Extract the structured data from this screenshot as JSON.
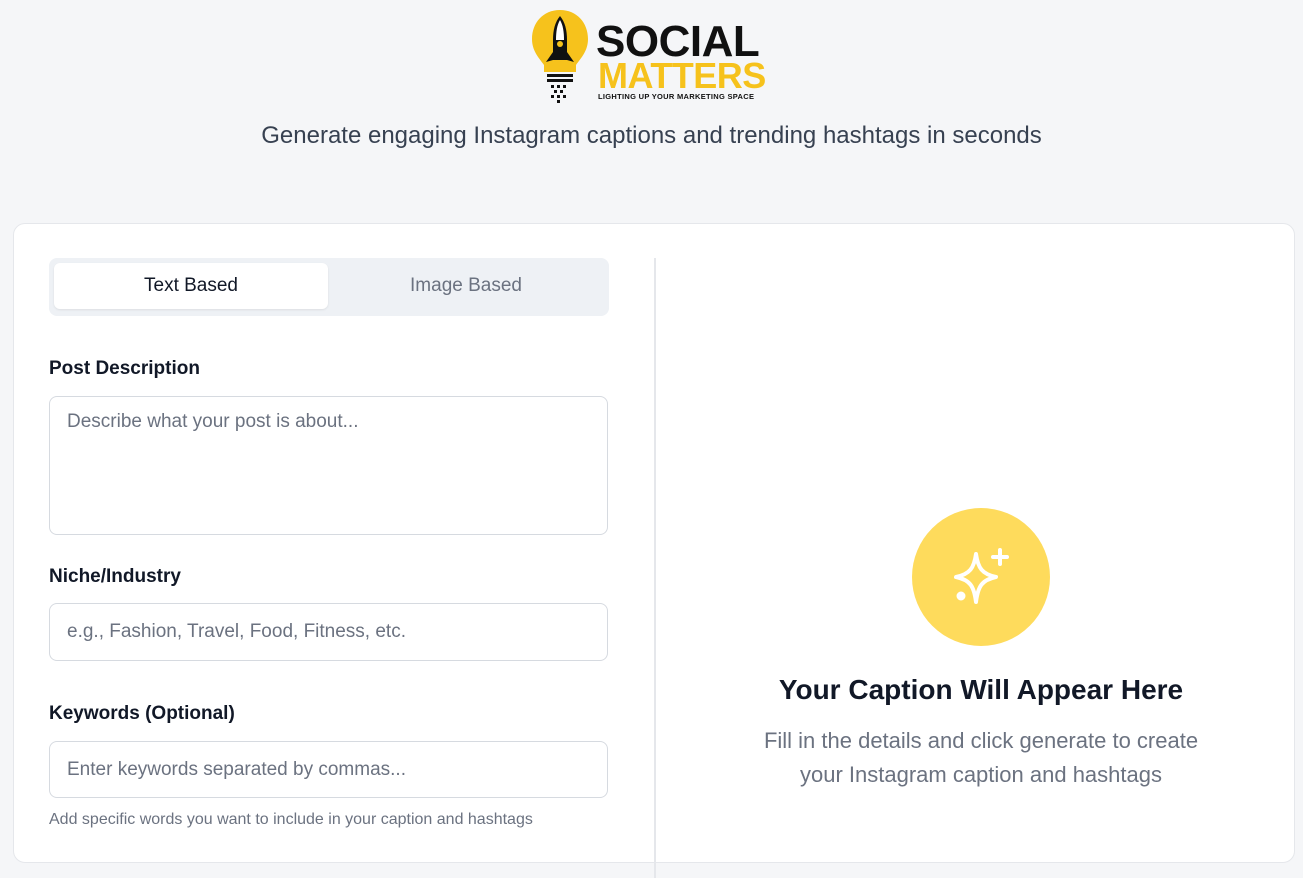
{
  "logo": {
    "brand_top": "SOCIAL",
    "brand_bottom": "MATTERS",
    "tagline": "LIGHTING UP YOUR MARKETING SPACE",
    "bulb_icon": "lightbulb-rocket-icon"
  },
  "header": {
    "subtitle": "Generate engaging Instagram captions and trending hashtags in seconds"
  },
  "tabs": [
    {
      "label": "Text Based",
      "active": true
    },
    {
      "label": "Image Based",
      "active": false
    }
  ],
  "form": {
    "post_description": {
      "label": "Post Description",
      "placeholder": "Describe what your post is about...",
      "value": ""
    },
    "niche": {
      "label": "Niche/Industry",
      "placeholder": "e.g., Fashion, Travel, Food, Fitness, etc.",
      "value": ""
    },
    "keywords": {
      "label": "Keywords (Optional)",
      "placeholder": "Enter keywords separated by commas...",
      "value": "",
      "hint": "Add specific words you want to include in your caption and hashtags"
    }
  },
  "result": {
    "icon": "sparkles-icon",
    "title": "Your Caption Will Appear Here",
    "description": "Fill in the details and click generate to create your Instagram caption and hashtags"
  },
  "colors": {
    "brand_yellow": "#f6c21c",
    "icon_circle": "#fedb5c",
    "page_bg": "#f5f6f8",
    "card_bg": "#ffffff"
  }
}
